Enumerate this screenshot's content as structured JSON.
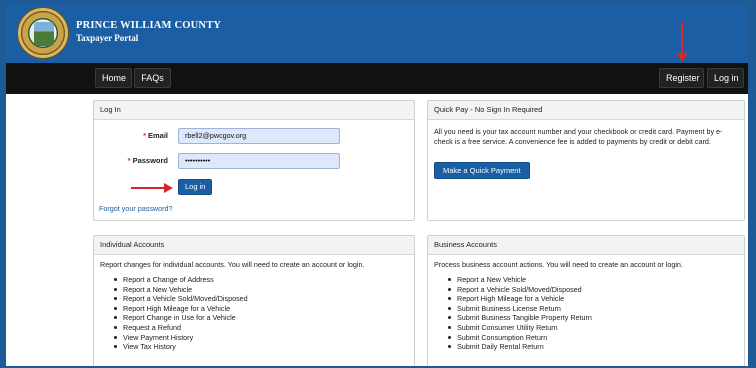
{
  "header": {
    "title": "PRINCE WILLIAM COUNTY",
    "subtitle": "Taxpayer Portal",
    "logo": "county-seal"
  },
  "nav": {
    "home": "Home",
    "faqs": "FAQs",
    "register": "Register",
    "login": "Log in"
  },
  "login_panel": {
    "title": "Log In",
    "email_label": "Email",
    "email_value": "rbell2@pwcgov.org",
    "password_label": "Password",
    "password_value": "••••••••••",
    "required_mark": "*",
    "login_button": "Log in",
    "forgot_link": "Forgot your password?"
  },
  "quick_pay": {
    "title": "Quick Pay - No Sign In Required",
    "text": "All you need is your tax account number and your checkbook or credit card. Payment by e-check is a free service. A convenience fee is added to payments by credit or debit card.",
    "button": "Make a Quick Payment"
  },
  "individual": {
    "title": "Individual Accounts",
    "intro": "Report changes for individual accounts. You will need to create an account or login.",
    "items": [
      "Report a Change of Address",
      "Report a New Vehicle",
      "Report a Vehicle Sold/Moved/Disposed",
      "Report High Mileage for a Vehicle",
      "Report Change in Use for a Vehicle",
      "Request a Refund",
      "View Payment History",
      "View Tax History"
    ]
  },
  "business": {
    "title": "Business Accounts",
    "intro": "Process business account actions. You will need to create an account or login.",
    "items": [
      "Report a New Vehicle",
      "Report a Vehicle Sold/Moved/Disposed",
      "Report High Mileage for a Vehicle",
      "Submit Business License Return",
      "Submit Business Tangible Property Return",
      "Submit Consumer Utility Return",
      "Submit Consumption Return",
      "Submit Daily Rental Return"
    ]
  },
  "colors": {
    "header_blue": "#1b5ea3",
    "nav_black": "#111111",
    "annotation_red": "#d9262b",
    "input_fill": "#dfe8fb"
  }
}
